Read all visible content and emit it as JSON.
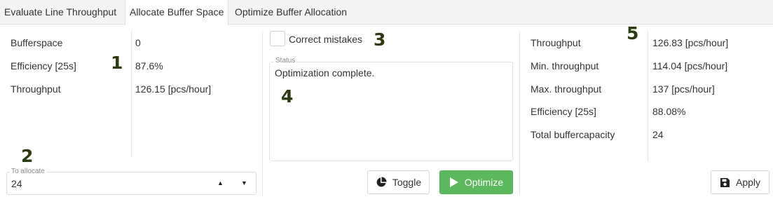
{
  "tabs": [
    {
      "label": "Evaluate Line Throughput",
      "active": false
    },
    {
      "label": "Allocate Buffer Space",
      "active": true
    },
    {
      "label": "Optimize Buffer Allocation",
      "active": false
    }
  ],
  "left_panel": {
    "rows": [
      {
        "label": "Bufferspace",
        "value": "0"
      },
      {
        "label": "Efficiency [25s]",
        "value": "87.6%"
      },
      {
        "label": "Throughput",
        "value": "126.15 [pcs/hour]"
      }
    ],
    "to_allocate": {
      "legend": "To allocate",
      "value": "24"
    }
  },
  "middle_panel": {
    "checkbox_label": "Correct mistakes",
    "checkbox_checked": false,
    "status_legend": "Status",
    "status_text": "Optimization complete.",
    "toggle_label": "Toggle",
    "optimize_label": "Optimize"
  },
  "right_panel": {
    "rows": [
      {
        "label": "Throughput",
        "value": "126.83 [pcs/hour]"
      },
      {
        "label": "Min. throughput",
        "value": "114.04 [pcs/hour]"
      },
      {
        "label": "Max. throughput",
        "value": "137 [pcs/hour]"
      },
      {
        "label": "Efficiency [25s]",
        "value": "88.08%"
      },
      {
        "label": "Total buffercapacity",
        "value": "24"
      }
    ],
    "apply_label": "Apply"
  },
  "annotations": [
    "1",
    "2",
    "3",
    "4",
    "5"
  ],
  "colors": {
    "accent_green": "#5cb85c",
    "annotation": "#2d3b12"
  },
  "icons": [
    "spin-up-icon",
    "dropdown-caret-icon",
    "pie-chart-icon",
    "play-icon",
    "save-icon"
  ]
}
